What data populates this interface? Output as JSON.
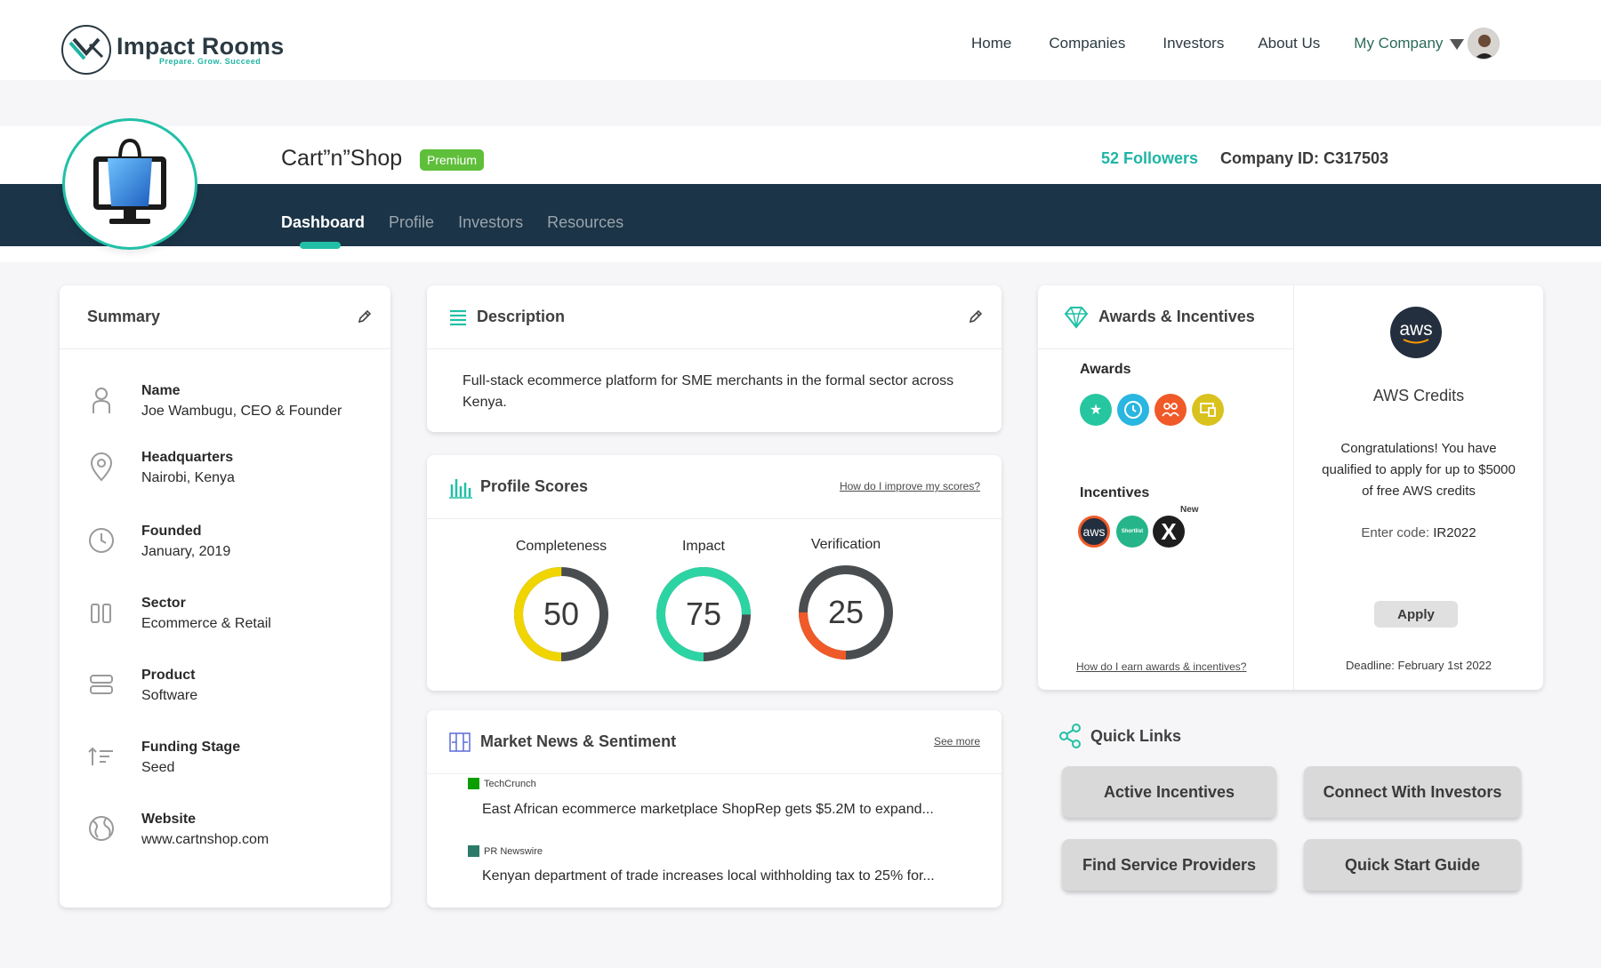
{
  "header": {
    "logo_title": "Impact Rooms",
    "logo_tagline": "Prepare. Grow. Succeed",
    "nav": [
      "Home",
      "Companies",
      "Investors",
      "About Us"
    ],
    "my_company": "My Company"
  },
  "company": {
    "name": "Cart”n”Shop",
    "badge": "Premium",
    "followers": "52 Followers",
    "company_id": "Company ID: C317503",
    "tabs": [
      "Dashboard",
      "Profile",
      "Investors",
      "Resources"
    ],
    "active_tab": "Dashboard"
  },
  "summary": {
    "title": "Summary",
    "items": [
      {
        "label": "Name",
        "value": "Joe Wambugu, CEO & Founder",
        "icon": "person-icon"
      },
      {
        "label": "Headquarters",
        "value": "Nairobi, Kenya",
        "icon": "location-pin-icon"
      },
      {
        "label": "Founded",
        "value": "January, 2019",
        "icon": "clock-icon"
      },
      {
        "label": "Sector",
        "value": "Ecommerce & Retail",
        "icon": "columns-icon"
      },
      {
        "label": "Product",
        "value": "Software",
        "icon": "server-icon"
      },
      {
        "label": "Funding Stage",
        "value": "Seed",
        "icon": "sort-ascending-icon"
      },
      {
        "label": "Website",
        "value": "www.cartnshop.com",
        "icon": "globe-icon"
      }
    ]
  },
  "description": {
    "title": "Description",
    "text": "Full-stack ecommerce platform for SME merchants in the formal sector across Kenya."
  },
  "scores": {
    "title": "Profile Scores",
    "help_link": "How do I improve my scores?",
    "items": [
      {
        "label": "Completeness",
        "value": "50",
        "percent": 50,
        "color": "#f1d500"
      },
      {
        "label": "Impact",
        "value": "75",
        "percent": 75,
        "color": "#2cd4a3"
      },
      {
        "label": "Verification",
        "value": "25",
        "percent": 25,
        "color": "#f05a28"
      }
    ],
    "track_color": "#4a4d50"
  },
  "news": {
    "title": "Market News & Sentiment",
    "see_more": "See  more",
    "items": [
      {
        "source": "TechCrunch",
        "headline": "East African ecommerce marketplace ShopRep gets $5.2M to expand..."
      },
      {
        "source": "PR Newswire",
        "headline": "Kenyan department of trade increases local withholding tax to 25% for..."
      }
    ]
  },
  "awards": {
    "title": "Awards & Incentives",
    "awards_label": "Awards",
    "award_icons": [
      {
        "icon": "star-icon",
        "color": "#26c6a0"
      },
      {
        "icon": "clock-icon",
        "color": "#29b6e0"
      },
      {
        "icon": "people-icon",
        "color": "#f05a28"
      },
      {
        "icon": "devices-icon",
        "color": "#d9c21e"
      }
    ],
    "incentives_label": "Incentives",
    "incentive_icons": [
      {
        "icon": "aws-icon",
        "text": "aws"
      },
      {
        "icon": "shortlist-icon",
        "text": "Shortlist"
      },
      {
        "icon": "x-icon",
        "text": "X"
      }
    ],
    "new_label": "New",
    "help_link": "How do I earn awards & incentives?"
  },
  "aws_panel": {
    "logo_text": "aws",
    "title": "AWS Credits",
    "body": "Congratulations! You have qualified to apply for up to $5000 of free AWS credits",
    "code_label": "Enter code: ",
    "code": "IR2022",
    "apply": "Apply",
    "deadline": "Deadline: February 1st 2022"
  },
  "quick_links": {
    "title": "Quick Links",
    "buttons": [
      "Active Incentives",
      "Connect With Investors",
      "Find Service Providers",
      "Quick Start Guide"
    ]
  },
  "colors": {
    "accent": "#21c0a6",
    "dark_band": "#1b3447",
    "premium": "#5fbf3a"
  }
}
